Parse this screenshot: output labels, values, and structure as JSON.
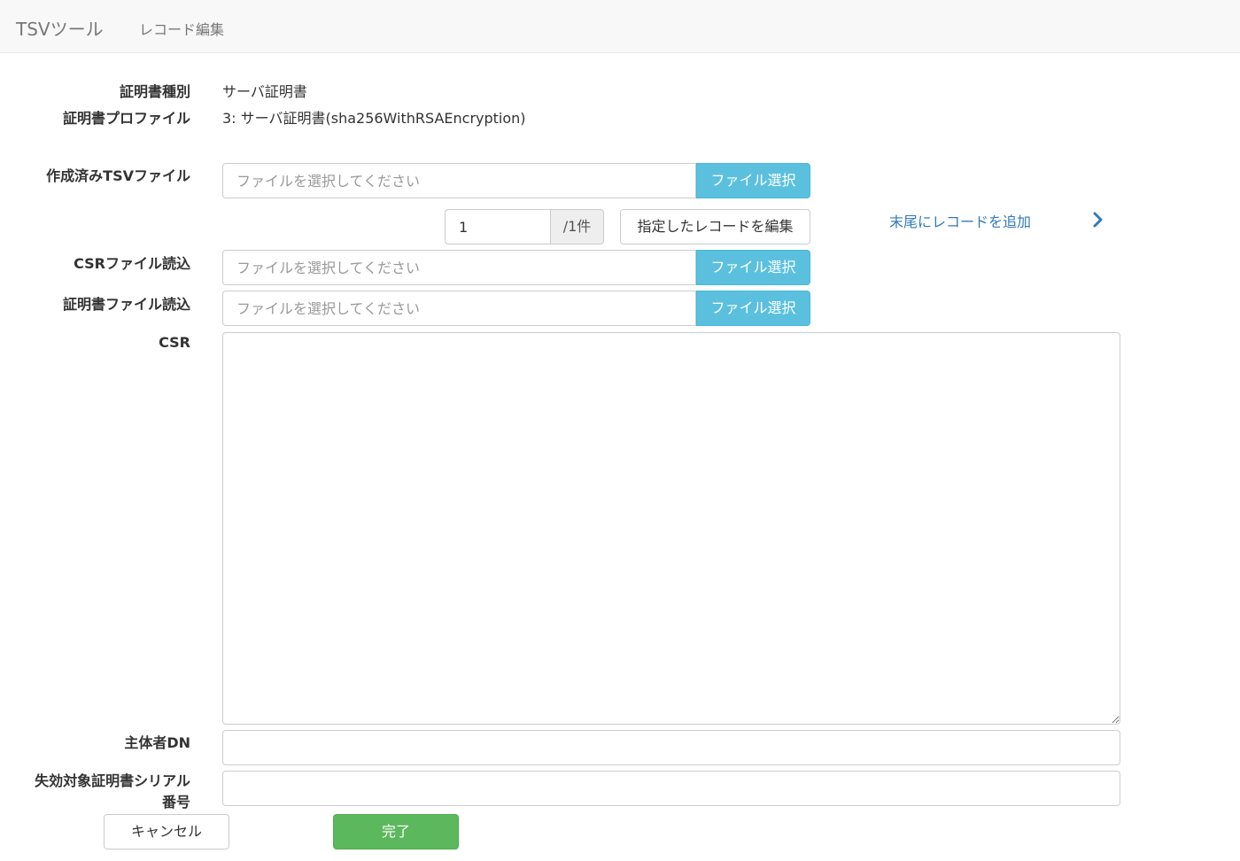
{
  "navbar": {
    "brand": "TSVツール",
    "link": "レコード編集"
  },
  "info": {
    "cert_type_label": "証明書種別",
    "cert_type_value": "サーバ証明書",
    "cert_profile_label": "証明書プロファイル",
    "cert_profile_value": "3: サーバ証明書(sha256WithRSAEncryption)"
  },
  "tsv_file": {
    "label": "作成済みTSVファイル",
    "placeholder": "ファイルを選択してください",
    "button": "ファイル選択"
  },
  "record": {
    "value": "1",
    "total": "/1件",
    "edit_button": "指定したレコードを編集",
    "append_link": "末尾にレコードを追加"
  },
  "csr_file": {
    "label": "CSRファイル読込",
    "placeholder": "ファイルを選択してください",
    "button": "ファイル選択"
  },
  "cert_file": {
    "label": "証明書ファイル読込",
    "placeholder": "ファイルを選択してください",
    "button": "ファイル選択"
  },
  "csr": {
    "label": "CSR",
    "value": ""
  },
  "subject_dn": {
    "label": "主体者DN",
    "value": ""
  },
  "revoke_serial": {
    "label": "失効対象証明書シリアル番号",
    "value": ""
  },
  "actions": {
    "cancel": "キャンセル",
    "done": "完了"
  },
  "colors": {
    "info_button": "#5bc0de",
    "success_button": "#5cb85c",
    "link": "#337ab7"
  },
  "icons": {
    "append": "chevron-right-icon"
  }
}
